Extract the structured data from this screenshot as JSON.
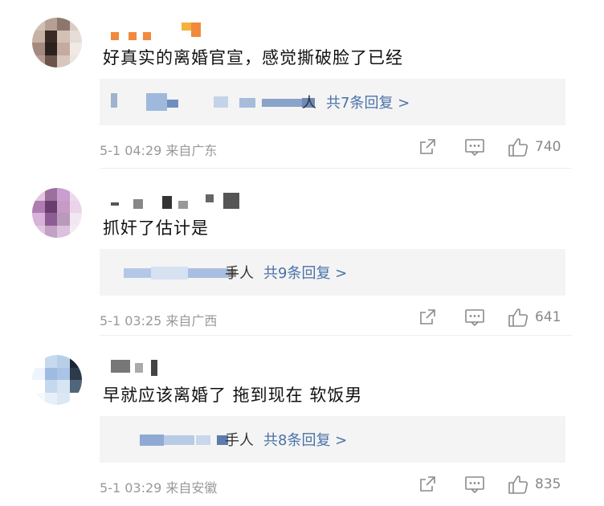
{
  "comments": [
    {
      "text": "好真实的离婚官宣，感觉撕破脸了已经",
      "replies_tail": "人",
      "replies_more": "共7条回复 >",
      "meta": "5-1 04:29 来自广东",
      "likes": "740",
      "avatar_colors": [
        "#cfc0b6",
        "#b89f94",
        "#8c776d",
        "#d9ccc4",
        "#c8b2a6",
        "#3a2a24",
        "#d4bfb3",
        "#e6dcd6",
        "#a48a7e",
        "#2d211d",
        "#c5ab9f",
        "#f0e9e5",
        "#b69c90",
        "#6b554b",
        "#d8c7be",
        "#ece4df"
      ],
      "name_colors": [
        "#f08a3c",
        "#f08a3c",
        "#f08a3c",
        "#f3b23c"
      ]
    },
    {
      "text": "抓奸了估计是",
      "replies_tail": "手人",
      "replies_more": "共9条回复 >",
      "meta": "5-1 03:25 来自广西",
      "likes": "641",
      "avatar_colors": [
        "#e3c6dd",
        "#9d6f9c",
        "#c89fd0",
        "#efd9ef",
        "#b07bb3",
        "#6a3d6f",
        "#c79bc6",
        "#e9d4ea",
        "#d7b2d9",
        "#8d5c92",
        "#b99abb",
        "#f3e6f3",
        "#e0c6e1",
        "#c3a0c5",
        "#dcc0dc",
        "#f4ecf4"
      ],
      "name_colors": [
        "#555555",
        "#888888",
        "#333333",
        "#999999",
        "#666666"
      ]
    },
    {
      "text": "早就应该离婚了  拖到现在  软饭男",
      "replies_tail": "手人",
      "replies_more": "共8条回复 >",
      "meta": "5-1 03:29 来自安徽",
      "likes": "835",
      "avatar_colors": [
        "#ffffff",
        "#c7d9ee",
        "#b8cfe8",
        "#1b2633",
        "#eef4fb",
        "#9fbbe0",
        "#a9c4e6",
        "#2c3a4a",
        "#ffffff",
        "#c4d8ef",
        "#d6e4f3",
        "#51657b",
        "#f6f9fc",
        "#e7eff8",
        "#dbe7f4",
        "#ffffff"
      ],
      "name_colors": [
        "#777777",
        "#aaaaaa",
        "#444444"
      ]
    }
  ]
}
